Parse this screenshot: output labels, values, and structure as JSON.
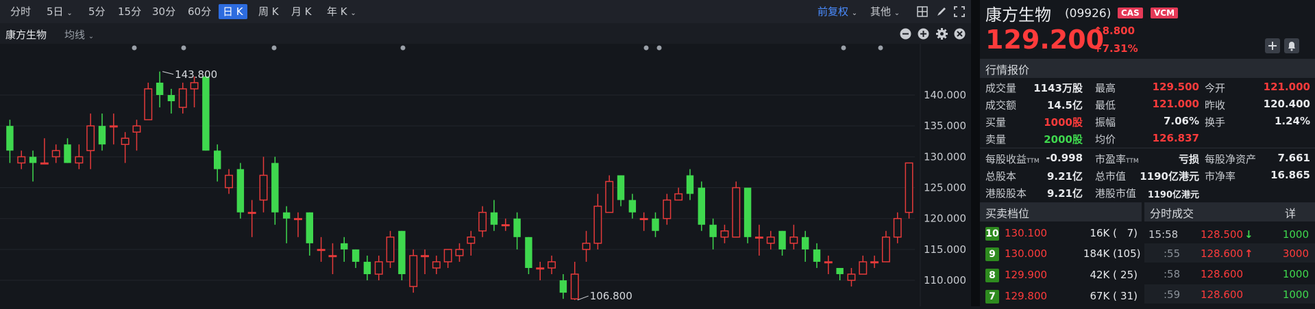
{
  "toolbar": {
    "timeframes": [
      {
        "label": "分时",
        "dropdown": false
      },
      {
        "label": "5日",
        "dropdown": true
      },
      {
        "label": "5分",
        "dropdown": false
      },
      {
        "label": "15分",
        "dropdown": false
      },
      {
        "label": "30分",
        "dropdown": false
      },
      {
        "label": "60分",
        "dropdown": false
      },
      {
        "label": "日 K",
        "dropdown": false,
        "active": true
      },
      {
        "label": "周 K",
        "dropdown": false
      },
      {
        "label": "月 K",
        "dropdown": false
      },
      {
        "label": "年 K",
        "dropdown": true
      }
    ],
    "adjust_label": "前复权",
    "other_label": "其他"
  },
  "chart_header": {
    "stock_name": "康方生物",
    "indicator_label": "均线"
  },
  "chart_data": {
    "type": "candlestick",
    "y_ticks": [
      140,
      135,
      130,
      125,
      120,
      115,
      110
    ],
    "y_tick_labels": [
      "140.000",
      "135.000",
      "130.000",
      "125.000",
      "120.000",
      "115.000",
      "110.000"
    ],
    "high_annotation": "143.800",
    "low_annotation": "106.800",
    "high_value": 143.8,
    "low_value": 106.8,
    "colors": {
      "up": "#e53a3a",
      "down": "#3fd84e"
    },
    "candles": [
      [
        135,
        131,
        136,
        129
      ],
      [
        129,
        130,
        131,
        128
      ],
      [
        130,
        129,
        131,
        126
      ],
      [
        129,
        129,
        133,
        129
      ],
      [
        130,
        131,
        132,
        129
      ],
      [
        132,
        129,
        133,
        129
      ],
      [
        129,
        130,
        132,
        128
      ],
      [
        131,
        135,
        137,
        128
      ],
      [
        135,
        132,
        137,
        131
      ],
      [
        135,
        135,
        137,
        132
      ],
      [
        132,
        133,
        134,
        129
      ],
      [
        134,
        135,
        136,
        131
      ],
      [
        136,
        141,
        142,
        136
      ],
      [
        142,
        140,
        143.8,
        138
      ],
      [
        140,
        139,
        141,
        137
      ],
      [
        138,
        141,
        142,
        137
      ],
      [
        141,
        142,
        143,
        138
      ],
      [
        143,
        131,
        143,
        131
      ],
      [
        131,
        128,
        132,
        126
      ],
      [
        125,
        127,
        128,
        124
      ],
      [
        128,
        121,
        129,
        120
      ],
      [
        121,
        121,
        123,
        117
      ],
      [
        123,
        127,
        130,
        121
      ],
      [
        129,
        121,
        130,
        119
      ],
      [
        121,
        120,
        122,
        116
      ],
      [
        120,
        120,
        121,
        117
      ],
      [
        121,
        116,
        121,
        114
      ],
      [
        115,
        115,
        117,
        113
      ],
      [
        114,
        114,
        116,
        111
      ],
      [
        116,
        115,
        117,
        113
      ],
      [
        115,
        113,
        115,
        112
      ],
      [
        113,
        111,
        114,
        110
      ],
      [
        111,
        113,
        114,
        110
      ],
      [
        113,
        117,
        118,
        112
      ],
      [
        118,
        111,
        118,
        110
      ],
      [
        109,
        114,
        115,
        108
      ],
      [
        114,
        114,
        115,
        111
      ],
      [
        112,
        113,
        114,
        111
      ],
      [
        113,
        115,
        115,
        112
      ],
      [
        114,
        115,
        116,
        113
      ],
      [
        116,
        117,
        118,
        114
      ],
      [
        118,
        121,
        122,
        117
      ],
      [
        121,
        119,
        123,
        118
      ],
      [
        119,
        119,
        120,
        118
      ],
      [
        120,
        117,
        121,
        115
      ],
      [
        117,
        112,
        117,
        111
      ],
      [
        112,
        112,
        113,
        110
      ],
      [
        112,
        113,
        114,
        111
      ],
      [
        110,
        108,
        111,
        107
      ],
      [
        107,
        111,
        113,
        106.8
      ],
      [
        115,
        116,
        118,
        113
      ],
      [
        116,
        122,
        124,
        115
      ],
      [
        121,
        126,
        127,
        121
      ],
      [
        127,
        123,
        127,
        122
      ],
      [
        123,
        121,
        124,
        120
      ],
      [
        120,
        120,
        121,
        118
      ],
      [
        120,
        118,
        121,
        117
      ],
      [
        120,
        123,
        124,
        119
      ],
      [
        123,
        124,
        125,
        123
      ],
      [
        127,
        124,
        128,
        123
      ],
      [
        125,
        119,
        126,
        118
      ],
      [
        119,
        117,
        120,
        115
      ],
      [
        117,
        118,
        119,
        116
      ],
      [
        117,
        125,
        126,
        117
      ],
      [
        125,
        117,
        125,
        116
      ],
      [
        117,
        117,
        119,
        114
      ],
      [
        116,
        117,
        118,
        115
      ],
      [
        118,
        115,
        118,
        114
      ],
      [
        116,
        117,
        119,
        115
      ],
      [
        117,
        115,
        118,
        113
      ],
      [
        115,
        113,
        116,
        112
      ],
      [
        113,
        113,
        114,
        111
      ],
      [
        112,
        111,
        112,
        110
      ],
      [
        110,
        111,
        112,
        109
      ],
      [
        111,
        113,
        114,
        111
      ],
      [
        113,
        113,
        114,
        112
      ],
      [
        113,
        117,
        118,
        113
      ],
      [
        117,
        120,
        121,
        116
      ],
      [
        121,
        129,
        129,
        120
      ]
    ]
  },
  "quote": {
    "name": "康方生物",
    "code": "(09926)",
    "badges": [
      "CAS",
      "VCM"
    ],
    "price": "129.200",
    "change": "8.800",
    "change_pct": "+7.31%",
    "section_title": "行情报价",
    "rows": [
      [
        {
          "l": "成交量",
          "v": "1143万股",
          "c": "white"
        },
        {
          "l": "最高",
          "v": "129.500",
          "c": "red"
        },
        {
          "l": "今开",
          "v": "121.000",
          "c": "red"
        }
      ],
      [
        {
          "l": "成交额",
          "v": "14.5亿",
          "c": "white"
        },
        {
          "l": "最低",
          "v": "121.000",
          "c": "red"
        },
        {
          "l": "昨收",
          "v": "120.400",
          "c": "white"
        }
      ],
      [
        {
          "l": "买量",
          "v": "1000股",
          "c": "red"
        },
        {
          "l": "振幅",
          "v": "7.06%",
          "c": "white"
        },
        {
          "l": "换手",
          "v": "1.24%",
          "c": "white"
        }
      ],
      [
        {
          "l": "卖量",
          "v": "2000股",
          "c": "green"
        },
        {
          "l": "均价",
          "v": "126.837",
          "c": "red"
        }
      ]
    ],
    "eps_label": "每股收益",
    "eps_sub": "TTM",
    "eps_value": "-0.998",
    "pe_label": "市盈率",
    "pe_sub": "TTM",
    "pe_value": "亏损",
    "bvps_label": "每股净资产",
    "bvps_value": "7.661",
    "total_shares_label": "总股本",
    "total_shares_value": "9.21亿",
    "mktcap_label": "总市值",
    "mktcap_value": "1190亿港元",
    "pb_label": "市净率",
    "pb_value": "16.865",
    "hk_shares_label": "港股股本",
    "hk_shares_value": "9.21亿",
    "hk_mktcap_label": "港股市值",
    "hk_mktcap_value": "1190亿港元"
  },
  "orderbook": {
    "title": "买卖档位",
    "levels": [
      {
        "level": "10",
        "price": "130.100",
        "vol": "16K (",
        "count": "7)"
      },
      {
        "level": "9",
        "price": "130.000",
        "vol": "184K (",
        "count": "105)"
      },
      {
        "level": "8",
        "price": "129.900",
        "vol": "42K (",
        "count": "25)"
      },
      {
        "level": "7",
        "price": "129.800",
        "vol": "67K (",
        "count": "31)"
      }
    ]
  },
  "ticks": {
    "title": "分时成交",
    "detail_label": "详",
    "rows": [
      {
        "time": "15:58",
        "price": "128.500",
        "arrow": "↓",
        "arrow_color": "green",
        "vol": "1000"
      },
      {
        "time": ":55",
        "price": "128.600",
        "arrow": "↑",
        "arrow_color": "red",
        "vol": "3000"
      },
      {
        "time": ":58",
        "price": "128.600",
        "arrow": "",
        "arrow_color": "",
        "vol": "1000"
      },
      {
        "time": ":59",
        "price": "128.600",
        "arrow": "",
        "arrow_color": "",
        "vol": "1000"
      }
    ]
  }
}
